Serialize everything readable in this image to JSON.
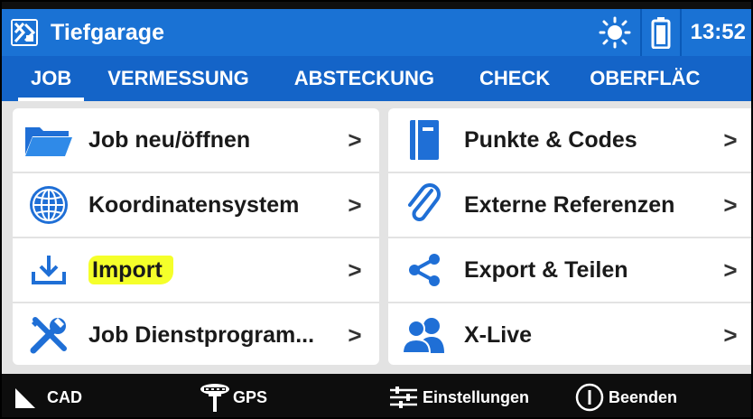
{
  "header": {
    "title": "Tiefgarage",
    "time": "13:52"
  },
  "tabs": [
    {
      "label": "JOB",
      "active": true
    },
    {
      "label": "VERMESSUNG",
      "active": false
    },
    {
      "label": "ABSTECKUNG",
      "active": false
    },
    {
      "label": "CHECK",
      "active": false
    },
    {
      "label": "OBERFLÄC",
      "active": false
    }
  ],
  "menu": {
    "left": [
      {
        "label": "Job neu/öffnen",
        "icon": "folder-icon"
      },
      {
        "label": "Koordinatensystem",
        "icon": "globe-icon"
      },
      {
        "label": "Import",
        "icon": "download-icon",
        "highlighted": true
      },
      {
        "label": "Job Dienstprogram...",
        "icon": "tools-icon"
      }
    ],
    "right": [
      {
        "label": "Punkte & Codes",
        "icon": "book-icon"
      },
      {
        "label": "Externe Referenzen",
        "icon": "paperclip-icon"
      },
      {
        "label": "Export & Teilen",
        "icon": "share-icon"
      },
      {
        "label": "X-Live",
        "icon": "users-icon"
      }
    ],
    "chevron": ">"
  },
  "bottombar": {
    "cad": "CAD",
    "gps": "GPS",
    "settings": "Einstellungen",
    "exit": "Beenden"
  },
  "colors": {
    "primary": "#1a72d4",
    "tab_bg": "#1464c8",
    "icon_blue": "#1f6fd6",
    "highlight": "#f5ff2a"
  }
}
